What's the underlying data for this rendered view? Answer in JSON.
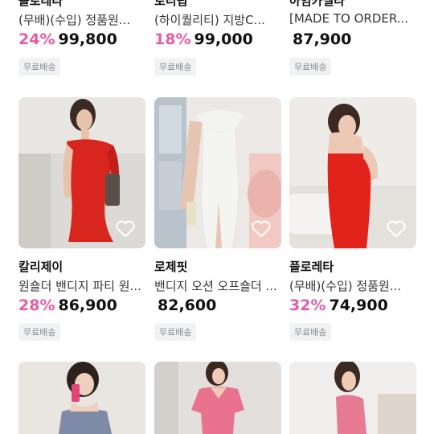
{
  "products": [
    {
      "store": "플로레타",
      "title": "(무배)(수입) 정품원...",
      "discount": "24%",
      "price": "99,800",
      "badge": "무료배송"
    },
    {
      "store": "로티핍",
      "title": "(하이퀄리티) 지방C...",
      "discount": "18%",
      "price": "99,000",
      "badge": "무료배송"
    },
    {
      "store": "아임카멜라",
      "title": "[MADE TO ORDER...",
      "discount": "",
      "price": "87,900",
      "badge": "무료배송"
    },
    {
      "store": "칼리제이",
      "title": "원숄더 밴디지 파티 원...",
      "discount": "28%",
      "price": "86,900",
      "badge": "무료배송"
    },
    {
      "store": "로제핏",
      "title": "밴디지 오션 오프숄더 ...",
      "discount": "",
      "price": "82,600",
      "badge": "무료배송"
    },
    {
      "store": "플로레타",
      "title": "(무배)(수입) 정품원...",
      "discount": "32%",
      "price": "74,900",
      "badge": "무료배송"
    }
  ],
  "colors": {
    "discount": "#e75ca4",
    "badge_bg": "#f1f2f4"
  },
  "icons": {
    "wishlist": "heart-outline-icon"
  }
}
